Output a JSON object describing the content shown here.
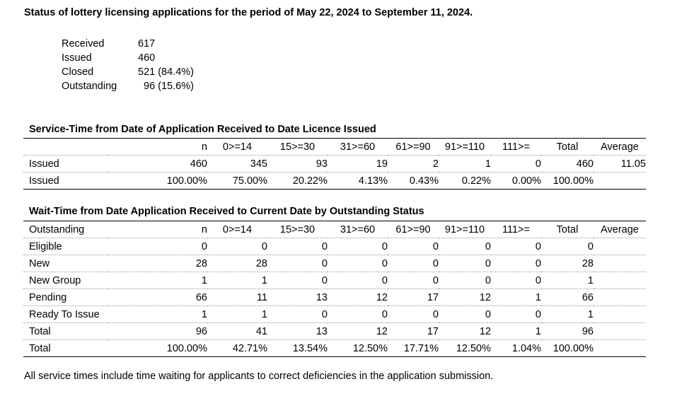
{
  "title": "Status of lottery licensing applications for the period of May 22, 2024 to September 11, 2024.",
  "summary": [
    {
      "label": "Received",
      "value": "617"
    },
    {
      "label": "Issued",
      "value": "460"
    },
    {
      "label": "Closed",
      "value": "521 (84.4%)"
    },
    {
      "label": "Outstanding",
      "value": "96 (15.6%)"
    }
  ],
  "service_time": {
    "title": "Service-Time from Date of Application Received to Date Licence Issued",
    "header": [
      "",
      "n",
      "0>=14",
      "15>=30",
      "31>=60",
      "61>=90",
      "91>=110",
      "111>=",
      "Total",
      "Average"
    ],
    "rows": [
      [
        "Issued",
        "460",
        "345",
        "93",
        "19",
        "2",
        "1",
        "0",
        "460",
        "11.05"
      ],
      [
        "Issued",
        "100.00%",
        "75.00%",
        "20.22%",
        "4.13%",
        "0.43%",
        "0.22%",
        "0.00%",
        "100.00%",
        ""
      ]
    ]
  },
  "wait_time": {
    "title": "Wait-Time from Date Application Received to Current Date by Outstanding Status",
    "header": [
      "Outstanding",
      "n",
      "0>=14",
      "15>=30",
      "31>=60",
      "61>=90",
      "91>=110",
      "111>=",
      "Total",
      "Average"
    ],
    "rows": [
      [
        "Eligible",
        "0",
        "0",
        "0",
        "0",
        "0",
        "0",
        "0",
        "0",
        ""
      ],
      [
        "New",
        "28",
        "28",
        "0",
        "0",
        "0",
        "0",
        "0",
        "28",
        ""
      ],
      [
        "New Group",
        "1",
        "1",
        "0",
        "0",
        "0",
        "0",
        "0",
        "1",
        ""
      ],
      [
        "Pending",
        "66",
        "11",
        "13",
        "12",
        "17",
        "12",
        "1",
        "66",
        ""
      ],
      [
        "Ready To Issue",
        "1",
        "1",
        "0",
        "0",
        "0",
        "0",
        "0",
        "1",
        ""
      ],
      [
        "Total",
        "96",
        "41",
        "13",
        "12",
        "17",
        "12",
        "1",
        "96",
        ""
      ],
      [
        "Total",
        "100.00%",
        "42.71%",
        "13.54%",
        "12.50%",
        "17.71%",
        "12.50%",
        "1.04%",
        "100.00%",
        ""
      ]
    ]
  },
  "footnote": "All service times include time waiting for applicants to correct deficiencies in the application submission."
}
